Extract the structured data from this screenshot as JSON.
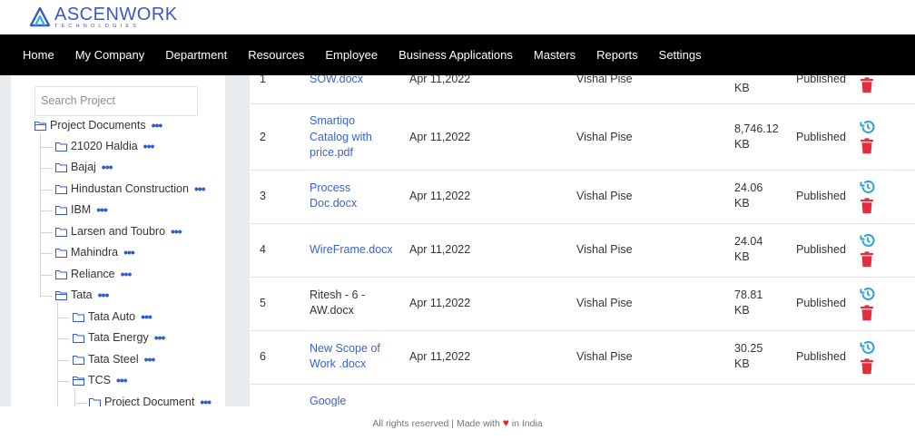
{
  "brand": {
    "name": "ASCENWORK",
    "tagline": "TECHNOLOGIES",
    "color": "#3b57c8"
  },
  "nav": [
    "Home",
    "My Company",
    "Department",
    "Resources",
    "Employee",
    "Business Applications",
    "Masters",
    "Reports",
    "Settings"
  ],
  "sidebar": {
    "search_placeholder": "Search Project",
    "root": "Project Documents",
    "items": [
      "21020 Haldia",
      "Bajaj",
      "Hindustan Construction",
      "IBM",
      "Larsen and Toubro",
      "Mahindra",
      "Reliance",
      "Tata"
    ],
    "tata_children": [
      "Tata Auto",
      "Tata Energy",
      "Tata Steel",
      "TCS"
    ],
    "tcs_children": [
      "Project Document"
    ],
    "dots": "•••"
  },
  "table": {
    "rows": [
      {
        "num": "1",
        "name": [
          "SOW.docx"
        ],
        "date": "Apr 11,2022",
        "owner": "Vishal Pise",
        "size": [
          "",
          "KB"
        ],
        "status": "Published",
        "link": true
      },
      {
        "num": "2",
        "name": [
          "Smartiqo",
          "Catalog with",
          "price.pdf"
        ],
        "date": "Apr 11,2022",
        "owner": "Vishal Pise",
        "size": [
          "8,746.12",
          "KB"
        ],
        "status": "Published",
        "link": true
      },
      {
        "num": "3",
        "name": [
          "Process",
          "Doc.docx"
        ],
        "date": "Apr 11,2022",
        "owner": "Vishal Pise",
        "size": [
          "24.06",
          "KB"
        ],
        "status": "Published",
        "link": true
      },
      {
        "num": "4",
        "name": [
          "WireFrame.docx"
        ],
        "date": "Apr 11,2022",
        "owner": "Vishal Pise",
        "size": [
          "24.04",
          "KB"
        ],
        "status": "Published",
        "link": true
      },
      {
        "num": "5",
        "name": [
          "Ritesh - 6 -",
          "AW.docx"
        ],
        "date": "Apr 11,2022",
        "owner": "Vishal Pise",
        "size": [
          "78.81",
          "KB"
        ],
        "status": "Published",
        "link": false
      },
      {
        "num": "6",
        "name": [
          "New Scope of",
          "Work .docx"
        ],
        "date": "Apr 11,2022",
        "owner": "Vishal Pise",
        "size": [
          "30.25",
          "KB"
        ],
        "status": "Published",
        "link": true
      },
      {
        "num": "",
        "name": [
          "Google"
        ],
        "date": "",
        "owner": "",
        "size": [
          "",
          ""
        ],
        "status": "",
        "link": true
      }
    ],
    "colors": {
      "link": "#3a63c9",
      "history_icon": "#2aa3d6",
      "delete_icon": "#e0303f"
    }
  },
  "footer": {
    "before": "All rights reserved | Made with",
    "after": "in India",
    "heart": "♥"
  }
}
